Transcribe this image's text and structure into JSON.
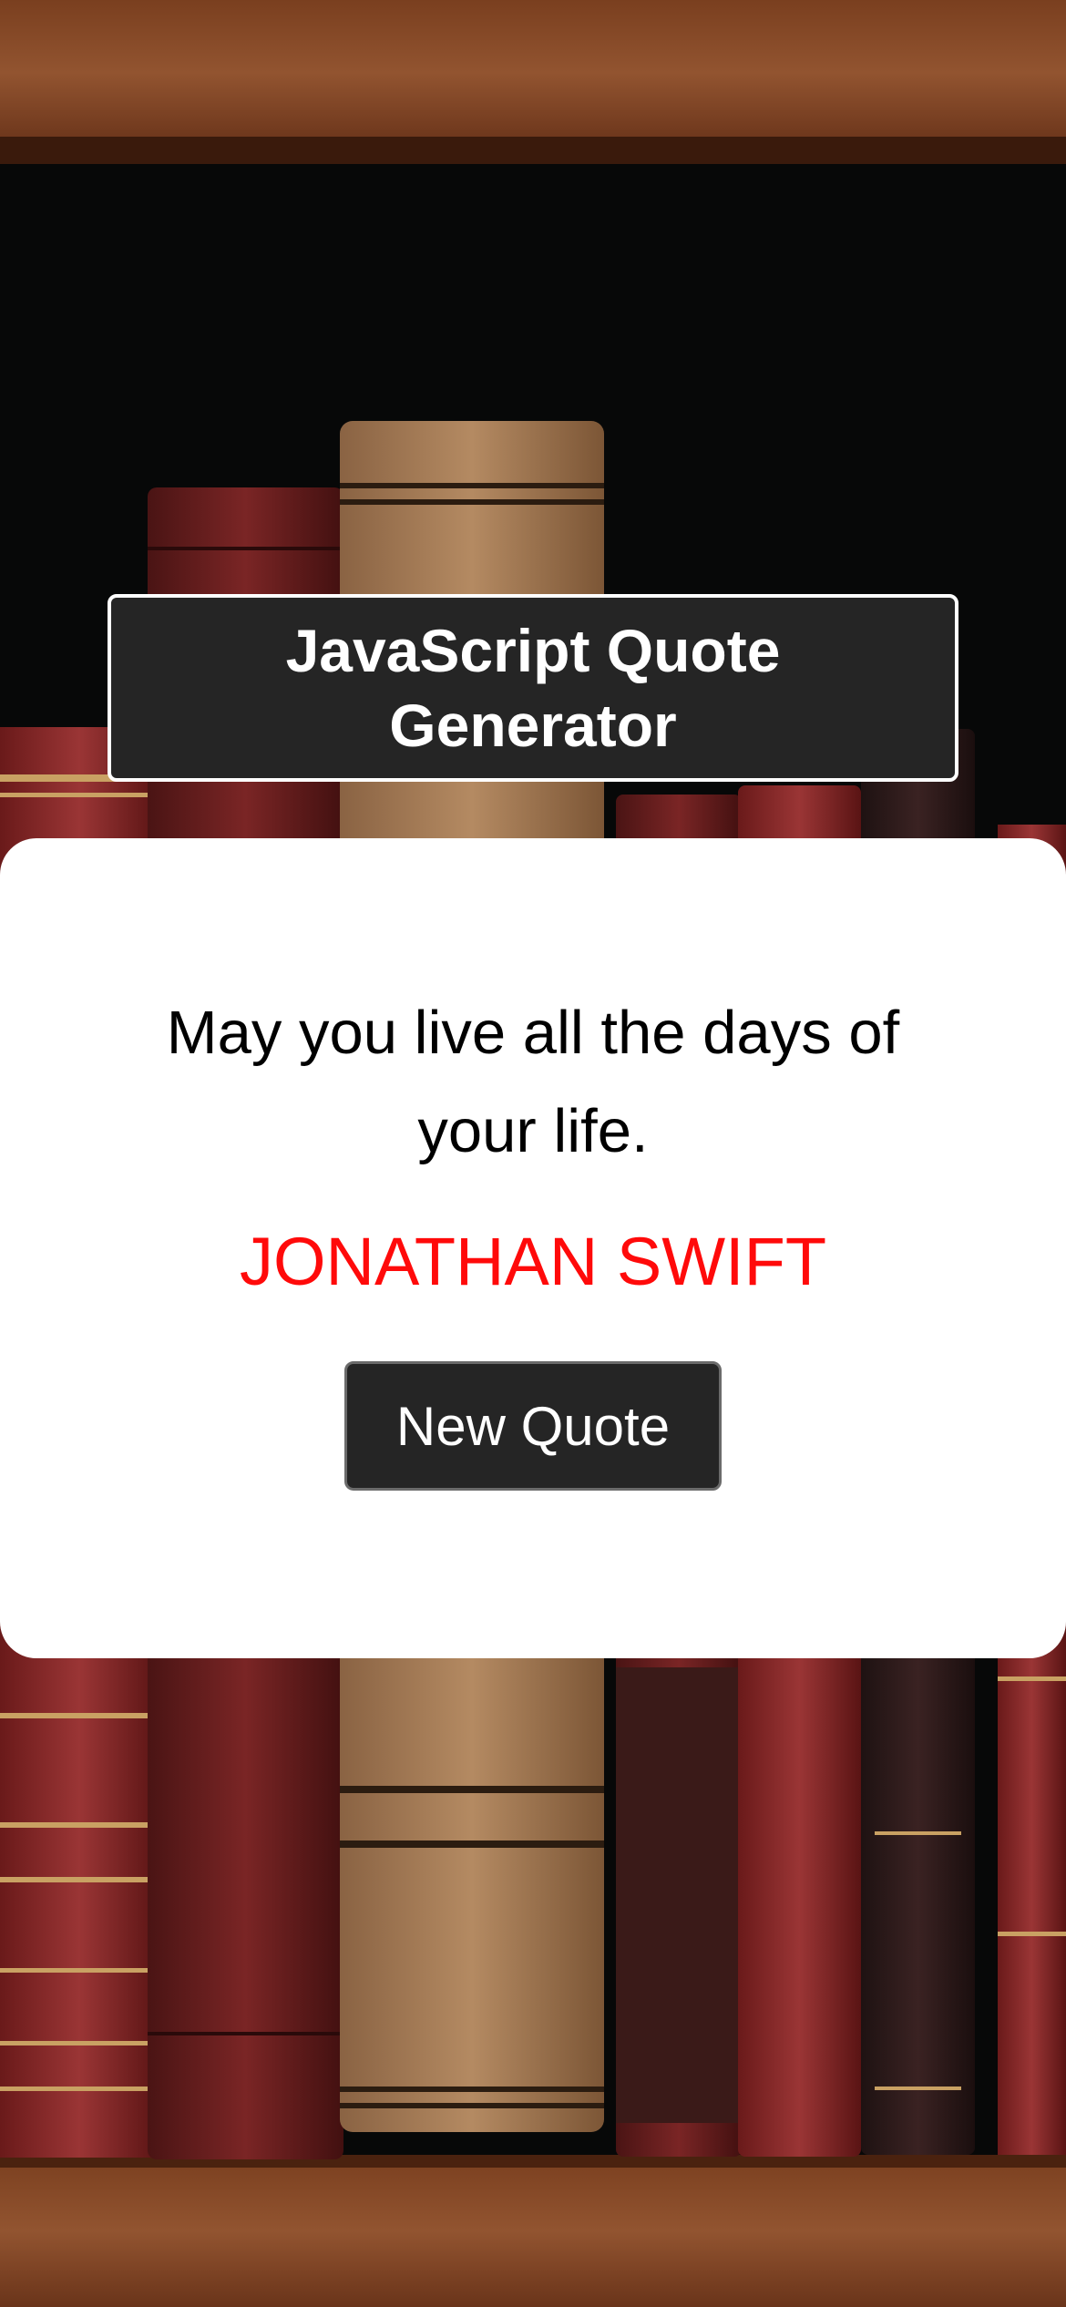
{
  "header": {
    "title": "JavaScript Quote Generator"
  },
  "quote": {
    "text": "May you live all the days of your life.",
    "author": "JONATHAN SWIFT"
  },
  "actions": {
    "new_quote_label": "New Quote"
  },
  "colors": {
    "title_background": "#252525",
    "card_background": "#ffffff",
    "author_color": "#ff0a0a",
    "button_background": "#252525"
  },
  "background": {
    "icon": "bookshelf-background"
  }
}
